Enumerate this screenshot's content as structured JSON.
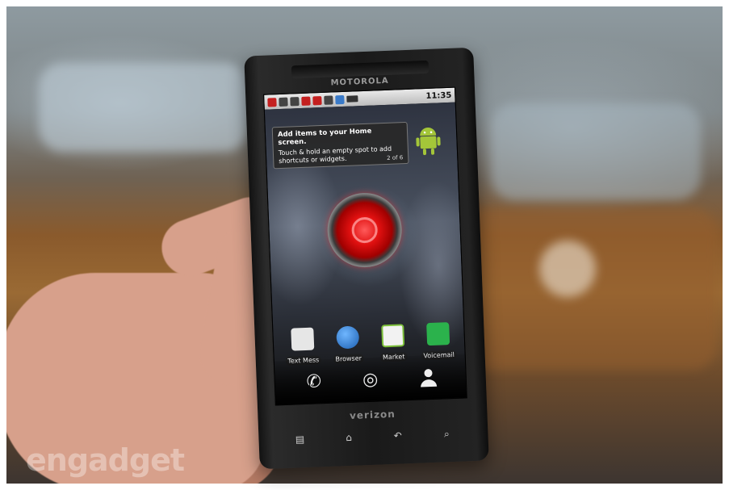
{
  "phone": {
    "brand": "MOTOROLA",
    "carrier": "verizon",
    "status_time": "11:35"
  },
  "tip": {
    "title": "Add items to your Home screen.",
    "body": "Touch & hold an empty spot to add shortcuts or widgets.",
    "count": "2 of 6"
  },
  "apps": [
    {
      "label": "Text Mess",
      "icon": "messaging-icon",
      "color": "#e6e6e6"
    },
    {
      "label": "Browser",
      "icon": "globe-icon",
      "color": "#2a7fd8"
    },
    {
      "label": "Market",
      "icon": "market-bag-icon",
      "color": "#f2f2f2"
    },
    {
      "label": "Voicemail",
      "icon": "voicemail-icon",
      "color": "#2bb24c"
    }
  ],
  "dock": [
    {
      "name": "phone-icon",
      "glyph": "✆"
    },
    {
      "name": "launcher-icon",
      "glyph": "◎"
    },
    {
      "name": "contacts-icon",
      "glyph": "👤"
    }
  ],
  "watermark": "engadget",
  "colors": {
    "eye_red": "#e01010",
    "android_green": "#a4c639"
  }
}
